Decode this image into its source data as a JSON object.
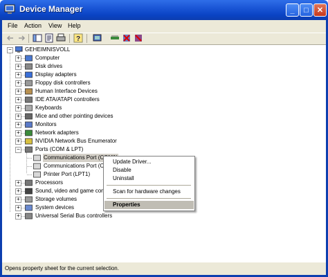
{
  "window": {
    "title": "Device Manager"
  },
  "title_buttons": {
    "minimize": "_",
    "maximize": "□",
    "close": "✕"
  },
  "menu": [
    "File",
    "Action",
    "View",
    "Help"
  ],
  "toolbar_icons": [
    "back-icon",
    "forward-icon",
    "show-hide-icon",
    "properties-icon",
    "print-icon",
    "help-icon",
    "scan-icon",
    "update-driver-icon",
    "uninstall-icon",
    "disable-icon"
  ],
  "tree": {
    "root": "GEHEIMNISVOLL",
    "categories": [
      "Computer",
      "Disk drives",
      "Display adapters",
      "Floppy disk controllers",
      "Human Interface Devices",
      "IDE ATA/ATAPI controllers",
      "Keyboards",
      "Mice and other pointing devices",
      "Monitors",
      "Network adapters",
      "NVIDIA Network Bus Enumerator",
      "Ports (COM & LPT)"
    ],
    "ports_children": [
      "Communications Port (COM1)",
      "Communications Port (COM2)",
      "Printer Port (LPT1)"
    ],
    "after_categories": [
      "Processors",
      "Sound, video and game controllers",
      "Storage volumes",
      "System devices",
      "Universal Serial Bus controllers"
    ]
  },
  "context_menu": {
    "update_driver": "Update Driver...",
    "disable": "Disable",
    "uninstall": "Uninstall",
    "scan": "Scan for hardware changes",
    "properties": "Properties"
  },
  "status": "Opens property sheet for the current selection.",
  "colors": {
    "titlebar": "#0a43c4",
    "chrome": "#ece9d8",
    "selection": "#d4d0c8"
  }
}
